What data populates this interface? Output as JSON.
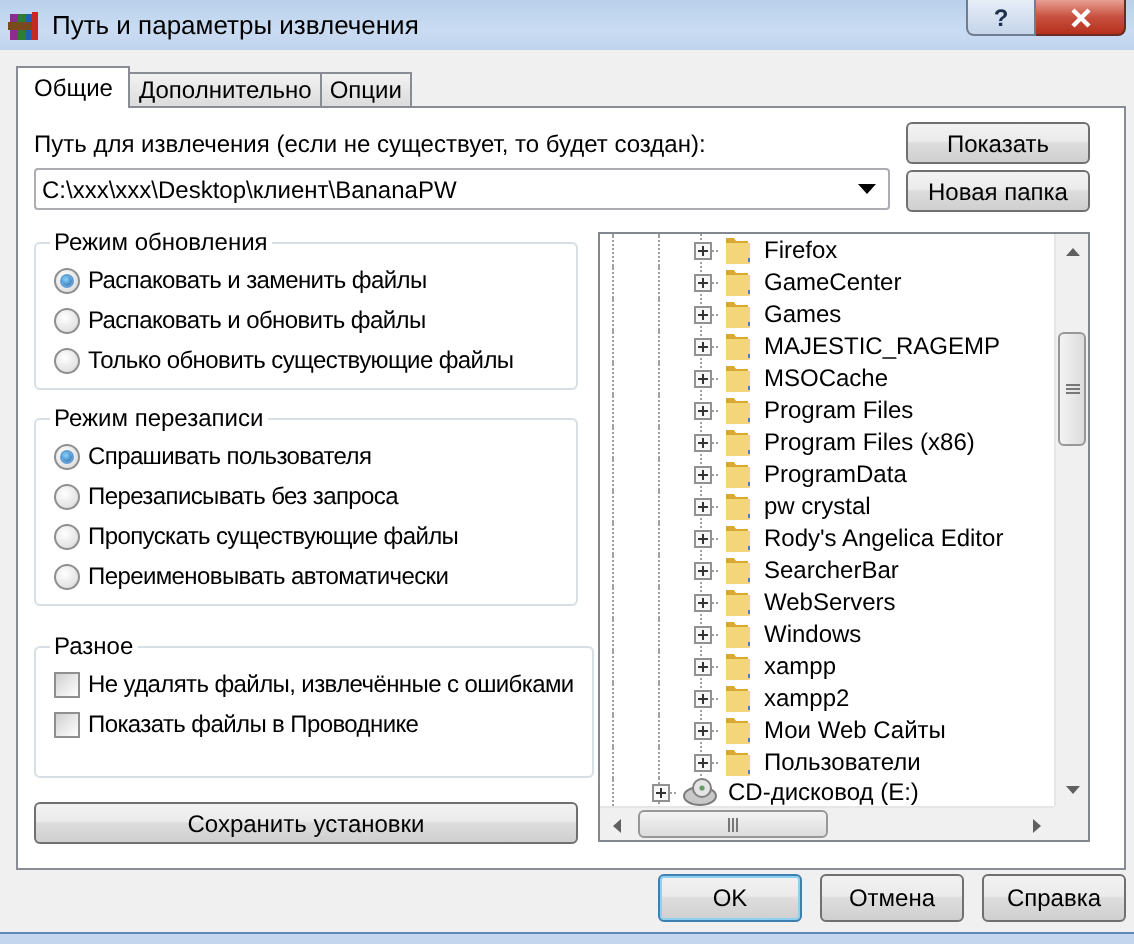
{
  "window": {
    "title": "Путь и параметры извлечения",
    "help_glyph": "?"
  },
  "tabs": [
    {
      "label": "Общие",
      "selected": true
    },
    {
      "label": "Дополнительно",
      "selected": false
    },
    {
      "label": "Опции",
      "selected": false
    }
  ],
  "path": {
    "label": "Путь для извлечения (если не существует, то будет создан):",
    "value": "C:\\xxx\\xxx\\Desktop\\клиент\\BananaPW"
  },
  "side_buttons": [
    "Показать",
    "Новая папка"
  ],
  "groups": [
    {
      "title": "Режим обновления",
      "kind": "radio",
      "options": [
        {
          "label": "Распаковать и заменить файлы",
          "selected": true
        },
        {
          "label": "Распаковать и обновить файлы",
          "selected": false
        },
        {
          "label": "Только обновить существующие файлы",
          "selected": false
        }
      ]
    },
    {
      "title": "Режим перезаписи",
      "kind": "radio",
      "options": [
        {
          "label": "Спрашивать пользователя",
          "selected": true
        },
        {
          "label": "Перезаписывать без запроса",
          "selected": false
        },
        {
          "label": "Пропускать существующие файлы",
          "selected": false
        },
        {
          "label": "Переименовывать автоматически",
          "selected": false
        }
      ]
    },
    {
      "title": "Разное",
      "kind": "checkbox",
      "options": [
        {
          "label": "Не удалять файлы, извлечённые с ошибками",
          "checked": false
        },
        {
          "label": "Показать файлы в Проводнике",
          "checked": false
        }
      ]
    }
  ],
  "save_button": "Сохранить установки",
  "tree": {
    "folders": [
      {
        "label": "Firefox",
        "expanded": false
      },
      {
        "label": "GameCenter",
        "expanded": false
      },
      {
        "label": "Games",
        "expanded": false
      },
      {
        "label": "MAJESTIC_RAGEMP",
        "expanded": false
      },
      {
        "label": "MSOCache",
        "expanded": false
      },
      {
        "label": "Program Files",
        "expanded": false
      },
      {
        "label": "Program Files (x86)",
        "expanded": false
      },
      {
        "label": "ProgramData",
        "expanded": false
      },
      {
        "label": "pw crystal",
        "expanded": false
      },
      {
        "label": "Rody's Angelica Editor",
        "expanded": false
      },
      {
        "label": "SearcherBar",
        "expanded": false
      },
      {
        "label": "WebServers",
        "expanded": false
      },
      {
        "label": "Windows",
        "expanded": false
      },
      {
        "label": "xampp",
        "expanded": false
      },
      {
        "label": "xampp2",
        "expanded": false
      },
      {
        "label": "Мои Web Сайты",
        "expanded": false
      },
      {
        "label": "Пользователи",
        "expanded": false
      }
    ],
    "next_drive": {
      "label": "CD-дисковод (E:)",
      "expanded": false
    }
  },
  "buttons": [
    {
      "label": "OK",
      "default": true
    },
    {
      "label": "Отмена",
      "default": false
    },
    {
      "label": "Справка",
      "default": false
    }
  ]
}
